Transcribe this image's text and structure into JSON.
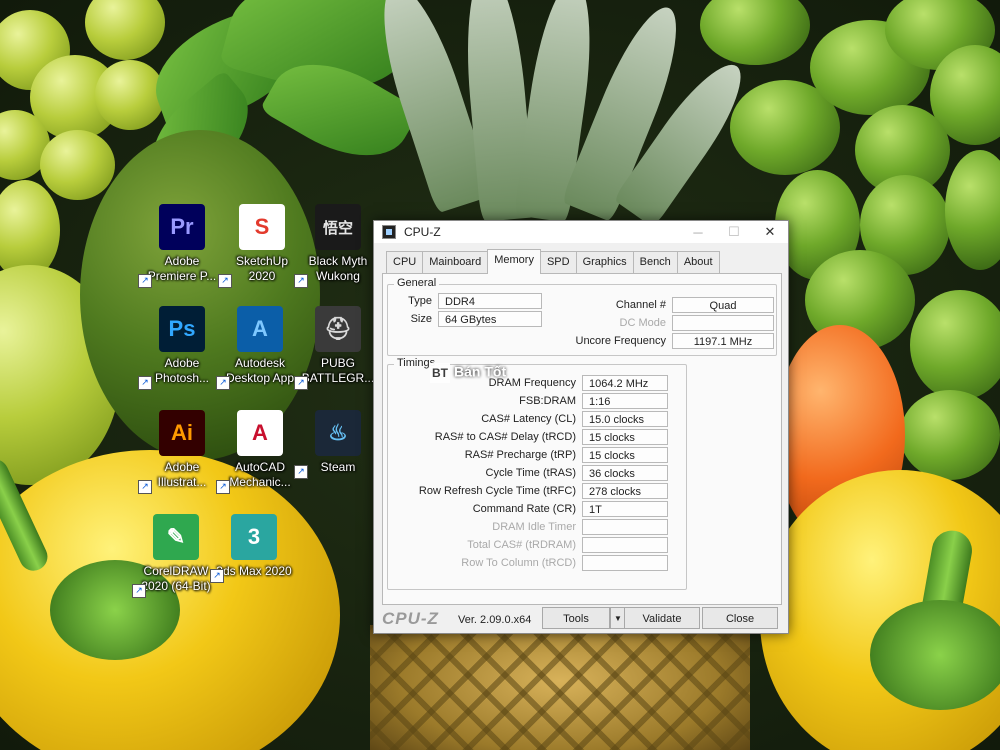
{
  "desktop": {
    "icons": [
      {
        "label": "Adobe\nPremiere P...",
        "glyph": "Pr",
        "color": "#00005b",
        "fg": "#9999ff"
      },
      {
        "label": "SketchUp\n2020",
        "glyph": "S",
        "color": "#ffffff",
        "fg": "#e33a2d"
      },
      {
        "label": "Black Myth\nWukong",
        "glyph": "悟空",
        "color": "#1a1a1a",
        "fg": "#e6e6e6"
      },
      {
        "label": "Adobe\nPhotosh...",
        "glyph": "Ps",
        "color": "#001e36",
        "fg": "#31a8ff"
      },
      {
        "label": "Autodesk\nDesktop App",
        "glyph": "A",
        "color": "#0b5ea8",
        "fg": "#7ec8ff"
      },
      {
        "label": "PUBG\nBATTLEGR...",
        "glyph": "⛑",
        "color": "#3a3a3a",
        "fg": "#d9d9d9"
      },
      {
        "label": "Adobe\nIllustrat...",
        "glyph": "Ai",
        "color": "#330000",
        "fg": "#ff9a00"
      },
      {
        "label": "AutoCAD\nMechanic...",
        "glyph": "A",
        "color": "#ffffff",
        "fg": "#c8102e"
      },
      {
        "label": "Steam",
        "glyph": "♨",
        "color": "#1b2838",
        "fg": "#66c0f4"
      },
      {
        "label": "CorelDRAW\n2020 (64-Bit)",
        "glyph": "✎",
        "color": "#2fa84f",
        "fg": "#ffffff"
      },
      {
        "label": "3ds Max 2020",
        "glyph": "3",
        "color": "#2aa6a0",
        "fg": "#ffffff"
      }
    ]
  },
  "window": {
    "title": "CPU-Z",
    "min_icon": "─",
    "max_icon": "☐",
    "close_icon": "✕",
    "tabs": [
      "CPU",
      "Mainboard",
      "Memory",
      "SPD",
      "Graphics",
      "Bench",
      "About"
    ],
    "active_tab": "Memory",
    "general": {
      "title": "General",
      "type_label": "Type",
      "type_value": "DDR4",
      "size_label": "Size",
      "size_value": "64 GBytes",
      "channel_label": "Channel #",
      "channel_value": "Quad",
      "dc_mode_label": "DC Mode",
      "dc_mode_value": "",
      "uncore_label": "Uncore Frequency",
      "uncore_value": "1197.1 MHz"
    },
    "timings": {
      "title": "Timings",
      "rows": [
        {
          "label": "DRAM Frequency",
          "value": "1064.2 MHz",
          "dim": false
        },
        {
          "label": "FSB:DRAM",
          "value": "1:16",
          "dim": false
        },
        {
          "label": "CAS# Latency (CL)",
          "value": "15.0 clocks",
          "dim": false
        },
        {
          "label": "RAS# to CAS# Delay (tRCD)",
          "value": "15 clocks",
          "dim": false
        },
        {
          "label": "RAS# Precharge (tRP)",
          "value": "15 clocks",
          "dim": false
        },
        {
          "label": "Cycle Time (tRAS)",
          "value": "36 clocks",
          "dim": false
        },
        {
          "label": "Row Refresh Cycle Time (tRFC)",
          "value": "278 clocks",
          "dim": false
        },
        {
          "label": "Command Rate (CR)",
          "value": "1T",
          "dim": false
        },
        {
          "label": "DRAM Idle Timer",
          "value": "",
          "dim": true
        },
        {
          "label": "Total CAS# (tRDRAM)",
          "value": "",
          "dim": true
        },
        {
          "label": "Row To Column (tRCD)",
          "value": "",
          "dim": true
        }
      ]
    },
    "footer": {
      "logo": "CPU-Z",
      "version": "Ver. 2.09.0.x64",
      "tools_label": "Tools",
      "tools_arrow": "▼",
      "validate_label": "Validate",
      "close_label": "Close"
    }
  },
  "watermark": {
    "mark": "BT",
    "text": "Bán Tốt"
  }
}
